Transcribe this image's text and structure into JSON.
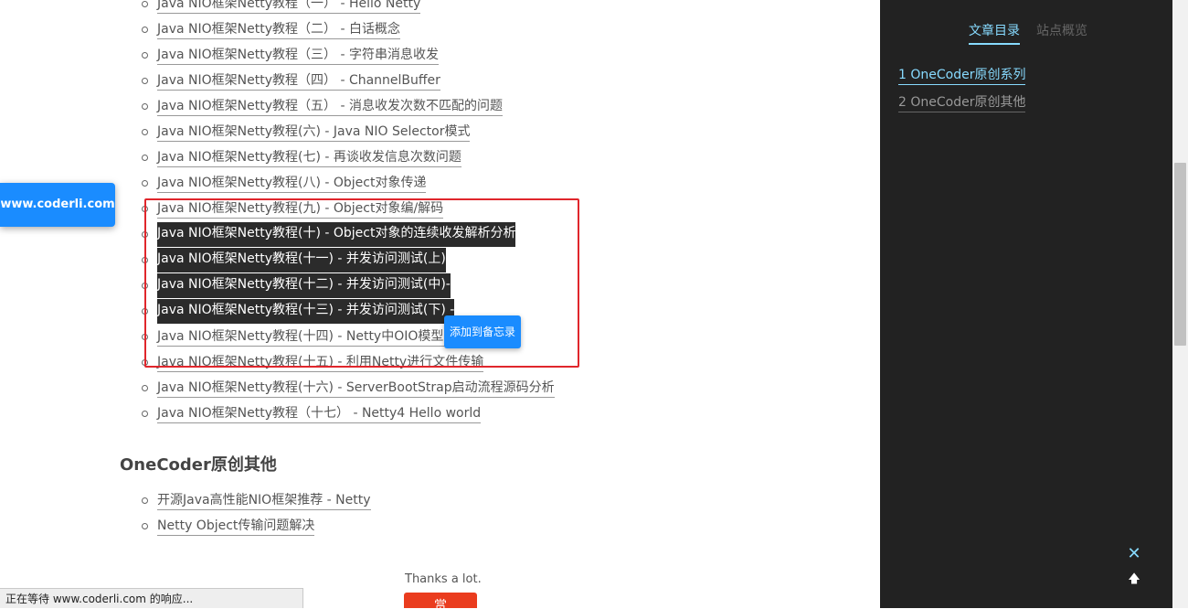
{
  "series_links": [
    {
      "label": "Java NIO框架Netty教程（一） - Hello Netty",
      "selected": false
    },
    {
      "label": "Java NIO框架Netty教程（二） - 白话概念",
      "selected": false
    },
    {
      "label": "Java NIO框架Netty教程（三） - 字符串消息收发",
      "selected": false
    },
    {
      "label": "Java NIO框架Netty教程（四） - ChannelBuffer",
      "selected": false
    },
    {
      "label": "Java NIO框架Netty教程（五） - 消息收发次数不匹配的问题",
      "selected": false
    },
    {
      "label": "Java NIO框架Netty教程(六) - Java NIO Selector模式",
      "selected": false
    },
    {
      "label": "Java NIO框架Netty教程(七) - 再谈收发信息次数问题",
      "selected": false
    },
    {
      "label": "Java NIO框架Netty教程(八) - Object对象传递",
      "selected": false
    },
    {
      "label": "Java NIO框架Netty教程(九) - Object对象编/解码",
      "selected": false
    },
    {
      "label": "Java NIO框架Netty教程(十) - Object对象的连续收发解析分析",
      "selected": true
    },
    {
      "label": "Java NIO框架Netty教程(十一) - 并发访问测试(上)",
      "selected": true
    },
    {
      "label": "Java NIO框架Netty教程(十二) - 并发访问测试(中)-",
      "selected": true
    },
    {
      "label": "Java NIO框架Netty教程(十三) - 并发访问测试(下) -",
      "selected": true
    },
    {
      "label": "Java NIO框架Netty教程(十四) - Netty中OIO模型(对",
      "selected": false
    },
    {
      "label": "Java NIO框架Netty教程(十五) - 利用Netty进行文件传输",
      "selected": false
    },
    {
      "label": "Java NIO框架Netty教程(十六) - ServerBootStrap启动流程源码分析",
      "selected": false
    },
    {
      "label": "Java NIO框架Netty教程（十七） - Netty4 Hello world",
      "selected": false
    }
  ],
  "other_heading": "OneCoder原创其他",
  "other_links": [
    {
      "label": "开源Java高性能NIO框架推荐 - Netty"
    },
    {
      "label": "Netty Object传输问题解决"
    }
  ],
  "site_badge": "www.coderli.com",
  "add_memo": "添加到备忘录",
  "thanks": "Thanks a lot.",
  "reward": "赏",
  "status": "正在等待 www.coderli.com 的响应...",
  "sidebar": {
    "tabs": [
      {
        "label": "文章目录",
        "active": true
      },
      {
        "label": "站点概览",
        "active": false
      }
    ],
    "toc": [
      {
        "label": "1 OneCoder原创系列",
        "active": true
      },
      {
        "label": "2 OneCoder原创其他",
        "active": false
      }
    ],
    "close_glyph": "✕",
    "back_top_glyph": "🡅"
  },
  "colors": {
    "accent": "#87daff",
    "selection_box": "#e0262c",
    "badge_blue": "#1a8cff",
    "reward_red": "#ea3c1e",
    "sidebar_bg": "#222222"
  }
}
